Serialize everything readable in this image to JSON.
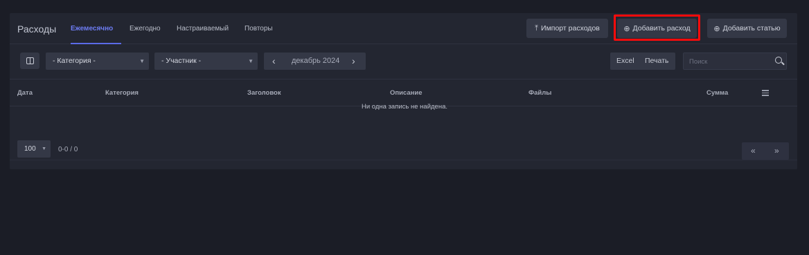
{
  "header": {
    "title": "Расходы",
    "tabs": [
      {
        "label": "Ежемесячно",
        "active": true
      },
      {
        "label": "Ежегодно"
      },
      {
        "label": "Настраиваемый"
      },
      {
        "label": "Повторы"
      }
    ],
    "import_label": "Импорт расходов",
    "add_expense_label": "Добавить расход",
    "add_item_label": "Добавить статью"
  },
  "toolbar": {
    "category_select": "- Категория -",
    "member_select": "- Участник -",
    "period": "декабрь 2024",
    "excel_label": "Excel",
    "print_label": "Печать",
    "search_placeholder": "Поиск"
  },
  "table": {
    "columns": [
      "Дата",
      "Категория",
      "Заголовок",
      "Описание",
      "Файлы",
      "Сумма"
    ],
    "empty_message": "Ни одна запись не найдена."
  },
  "footer": {
    "page_size": "100",
    "range": "0-0 / 0",
    "prev_label": "«",
    "next_label": "»"
  },
  "colors": {
    "accent": "#6d7cf2",
    "highlight": "#ff0b0b",
    "background": "#1b1d26",
    "panel": "#232631"
  }
}
